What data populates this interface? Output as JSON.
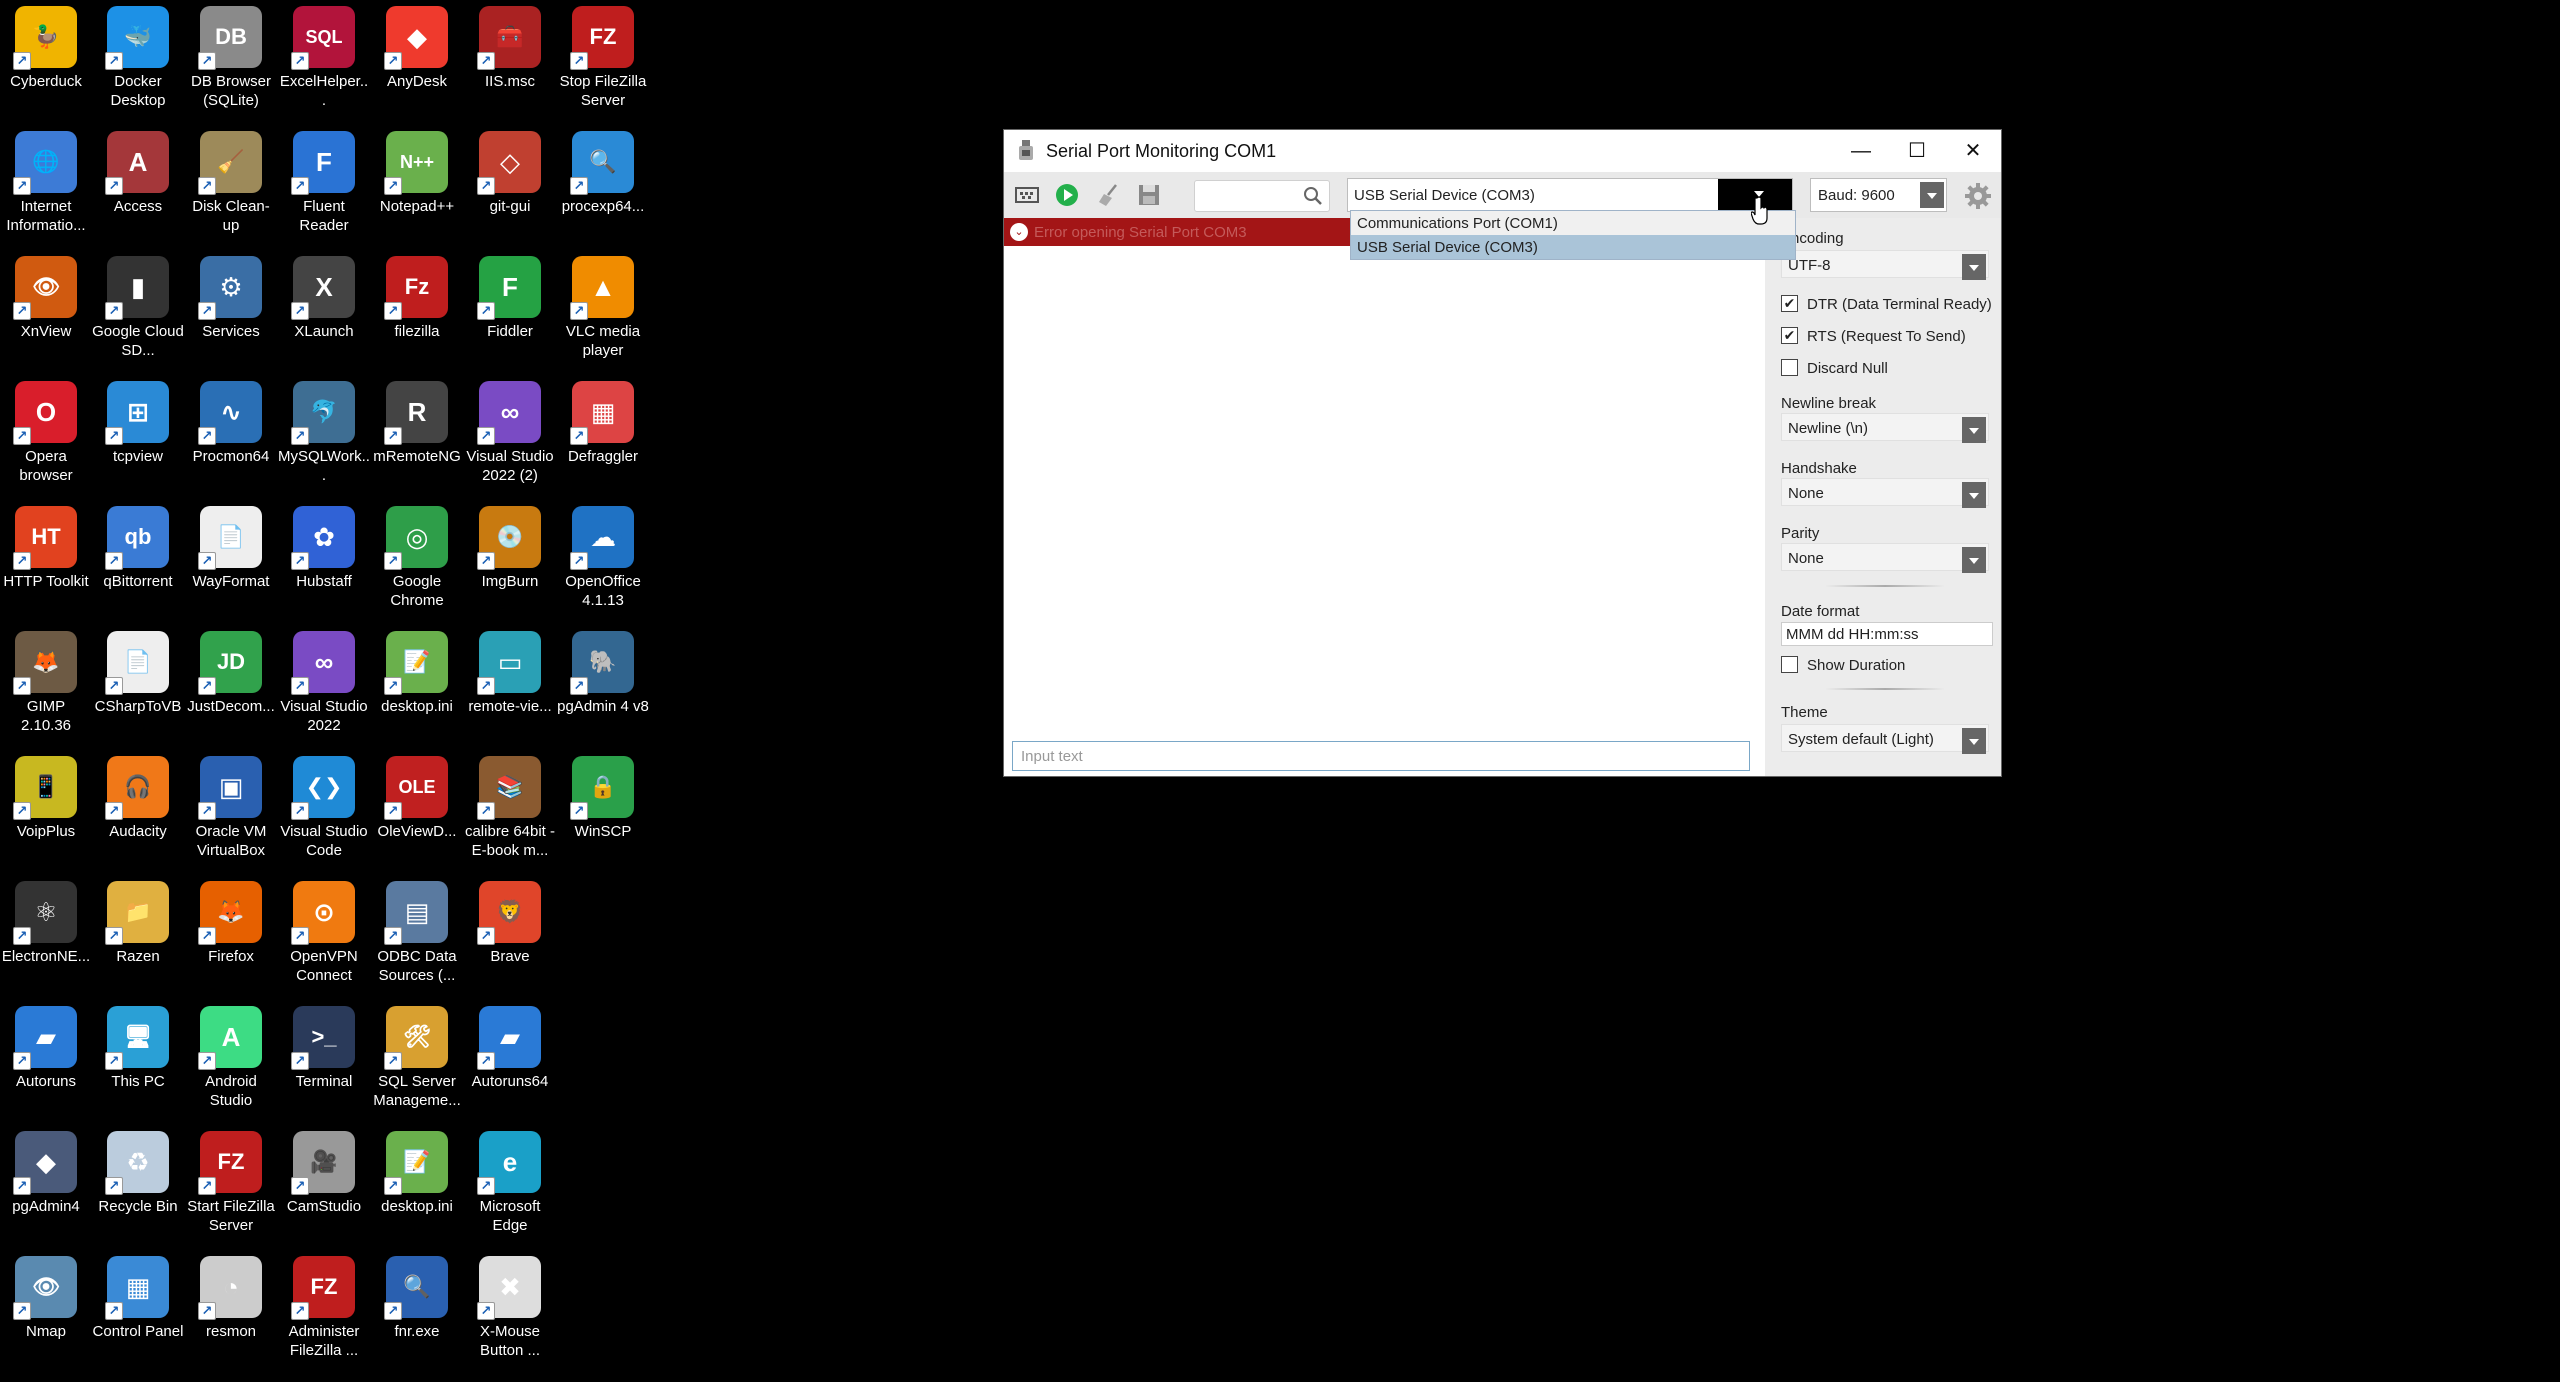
{
  "desktop": {
    "icons": [
      {
        "label": "Cyberduck",
        "color": "#f0b400",
        "glyph": "🦆"
      },
      {
        "label": "Docker Desktop",
        "color": "#1d91e6",
        "glyph": "🐳"
      },
      {
        "label": "DB Browser (SQLite)",
        "color": "#8a8a8a",
        "glyph": "DB"
      },
      {
        "label": "ExcelHelper...",
        "color": "#b2143b",
        "glyph": "SQL"
      },
      {
        "label": "AnyDesk",
        "color": "#ef3a2d",
        "glyph": "◆"
      },
      {
        "label": "IIS.msc",
        "color": "#a22",
        "glyph": "🧰"
      },
      {
        "label": "Stop FileZilla Server",
        "color": "#bf1e1e",
        "glyph": "FZ"
      },
      {
        "label": "Internet Informatio...",
        "color": "#3d7bd6",
        "glyph": "🌐"
      },
      {
        "label": "Access",
        "color": "#a4373a",
        "glyph": "A"
      },
      {
        "label": "Disk Clean-up",
        "color": "#9d8a5a",
        "glyph": "🧹"
      },
      {
        "label": "Fluent Reader",
        "color": "#2a73d4",
        "glyph": "F"
      },
      {
        "label": "Notepad++",
        "color": "#6ab04c",
        "glyph": "N++"
      },
      {
        "label": "git-gui",
        "color": "#c04030",
        "glyph": "◇"
      },
      {
        "label": "procexp64...",
        "color": "#2a8ad6",
        "glyph": "🔍"
      },
      {
        "label": "XnView",
        "color": "#d05a10",
        "glyph": "👁"
      },
      {
        "label": "Google Cloud SD...",
        "color": "#333",
        "glyph": "▮"
      },
      {
        "label": "Services",
        "color": "#3a6ea5",
        "glyph": "⚙"
      },
      {
        "label": "XLaunch",
        "color": "#444",
        "glyph": "X"
      },
      {
        "label": "filezilla",
        "color": "#bf1e1e",
        "glyph": "Fz"
      },
      {
        "label": "Fiddler",
        "color": "#25a244",
        "glyph": "F"
      },
      {
        "label": "VLC media player",
        "color": "#f08c00",
        "glyph": "▲"
      },
      {
        "label": "Opera browser",
        "color": "#d91e2b",
        "glyph": "O"
      },
      {
        "label": "tcpview",
        "color": "#2a8ad6",
        "glyph": "⊞"
      },
      {
        "label": "Procmon64",
        "color": "#2a6fb5",
        "glyph": "∿"
      },
      {
        "label": "MySQLWork...",
        "color": "#3e6e93",
        "glyph": "🐬"
      },
      {
        "label": "mRemoteNG",
        "color": "#444",
        "glyph": "R"
      },
      {
        "label": "Visual Studio 2022 (2)",
        "color": "#7a4bc4",
        "glyph": "∞"
      },
      {
        "label": "Defraggler",
        "color": "#d44",
        "glyph": "▦"
      },
      {
        "label": "HTTP Toolkit",
        "color": "#e1421f",
        "glyph": "HT"
      },
      {
        "label": "qBittorrent",
        "color": "#3a7bd5",
        "glyph": "qb"
      },
      {
        "label": "WayFormat",
        "color": "#eee",
        "glyph": "📄"
      },
      {
        "label": "Hubstaff",
        "color": "#3062d6",
        "glyph": "✿"
      },
      {
        "label": "Google Chrome",
        "color": "#2e9e49",
        "glyph": "◎"
      },
      {
        "label": "ImgBurn",
        "color": "#c87a10",
        "glyph": "💿"
      },
      {
        "label": "OpenOffice 4.1.13",
        "color": "#1f72c4",
        "glyph": "☁"
      },
      {
        "label": "GIMP 2.10.36",
        "color": "#6d5a44",
        "glyph": "🦊"
      },
      {
        "label": "CSharpToVB",
        "color": "#eee",
        "glyph": "📄"
      },
      {
        "label": "JustDecom...",
        "color": "#31a24c",
        "glyph": "JD"
      },
      {
        "label": "Visual Studio 2022",
        "color": "#7a4bc4",
        "glyph": "∞"
      },
      {
        "label": "desktop.ini",
        "color": "#6ab04c",
        "glyph": "📝"
      },
      {
        "label": "remote-vie...",
        "color": "#2aa0b5",
        "glyph": "▭"
      },
      {
        "label": "pgAdmin 4 v8",
        "color": "#336791",
        "glyph": "🐘"
      },
      {
        "label": "VoipPlus",
        "color": "#c8b820",
        "glyph": "📱"
      },
      {
        "label": "Audacity",
        "color": "#f07818",
        "glyph": "🎧"
      },
      {
        "label": "Oracle VM VirtualBox",
        "color": "#2a60b0",
        "glyph": "▣"
      },
      {
        "label": "Visual Studio Code",
        "color": "#1f8ad6",
        "glyph": "❮❯"
      },
      {
        "label": "OleViewD...",
        "color": "#c02020",
        "glyph": "OLE"
      },
      {
        "label": "calibre 64bit - E-book m...",
        "color": "#8a5a30",
        "glyph": "📚"
      },
      {
        "label": "WinSCP",
        "color": "#2aa04a",
        "glyph": "🔒"
      },
      {
        "label": "ElectronNE...",
        "color": "#333",
        "glyph": "⚛"
      },
      {
        "label": "Razen",
        "color": "#e0b040",
        "glyph": "📁"
      },
      {
        "label": "Firefox",
        "color": "#e66000",
        "glyph": "🦊"
      },
      {
        "label": "OpenVPN Connect",
        "color": "#f07a10",
        "glyph": "⊙"
      },
      {
        "label": "ODBC Data Sources (...",
        "color": "#5a7aa0",
        "glyph": "▤"
      },
      {
        "label": "Brave",
        "color": "#e0452a",
        "glyph": "🦁"
      },
      {
        "label": "Autoruns",
        "color": "#2a7ad6",
        "glyph": "▰"
      },
      {
        "label": "This PC",
        "color": "#2aa0d6",
        "glyph": "🖥"
      },
      {
        "label": "Android Studio",
        "color": "#3ddc84",
        "glyph": "A"
      },
      {
        "label": "Terminal",
        "color": "#2a3a5a",
        "glyph": ">_"
      },
      {
        "label": "SQL Server Manageme...",
        "color": "#d8a030",
        "glyph": "🛠"
      },
      {
        "label": "Autoruns64",
        "color": "#2a7ad6",
        "glyph": "▰"
      },
      {
        "label": "pgAdmin4",
        "color": "#4a5a7a",
        "glyph": "◆"
      },
      {
        "label": "Recycle Bin",
        "color": "#bcd",
        "glyph": "♻"
      },
      {
        "label": "Start FileZilla Server",
        "color": "#bf1e1e",
        "glyph": "FZ"
      },
      {
        "label": "CamStudio",
        "color": "#999",
        "glyph": "🎥"
      },
      {
        "label": "desktop.ini",
        "color": "#6ab04c",
        "glyph": "📝"
      },
      {
        "label": "Microsoft Edge",
        "color": "#1aa0c8",
        "glyph": "e"
      },
      {
        "label": "Nmap",
        "color": "#5a8ab0",
        "glyph": "👁"
      },
      {
        "label": "Control Panel",
        "color": "#3a8ad6",
        "glyph": "▦"
      },
      {
        "label": "resmon",
        "color": "#ccc",
        "glyph": "◔"
      },
      {
        "label": "Administer FileZilla ...",
        "color": "#bf1e1e",
        "glyph": "FZ"
      },
      {
        "label": "fnr.exe",
        "color": "#2a60b0",
        "glyph": "🔍"
      },
      {
        "label": "X-Mouse Button ...",
        "color": "#ddd",
        "glyph": "✖"
      }
    ]
  },
  "window": {
    "title": "Serial Port Monitoring COM1",
    "controls": {
      "minimize": "—",
      "maximize": "☐",
      "close": "✕"
    },
    "toolbar": {
      "search_placeholder": "",
      "port_value": "USB Serial Device (COM3)",
      "baud_value": "Baud: 9600"
    },
    "port_options": [
      {
        "label": "Communications Port (COM1)",
        "selected": false
      },
      {
        "label": "USB Serial Device (COM3)",
        "selected": true
      }
    ],
    "error_text": "Error opening Serial Port COM3",
    "input_placeholder": "Input text",
    "settings": {
      "encoding_label": "Encoding",
      "encoding_value": "UTF-8",
      "dtr_label": "DTR (Data Terminal Ready)",
      "dtr_checked": "✔",
      "rts_label": "RTS (Request To Send)",
      "rts_checked": "✔",
      "discard_null_label": "Discard Null",
      "newline_label": "Newline break",
      "newline_value": "Newline (\\n)",
      "handshake_label": "Handshake",
      "handshake_value": "None",
      "parity_label": "Parity",
      "parity_value": "None",
      "date_format_label": "Date format",
      "date_format_value": "MMM dd HH:mm:ss",
      "show_duration_label": "Show Duration",
      "theme_label": "Theme",
      "theme_value": "System default (Light)"
    }
  },
  "colors": {
    "error_bg": "#a31516",
    "selected_option": "#aac4d8",
    "panel_bg": "#ececec",
    "toolbar_bg": "#e9e9e9"
  }
}
